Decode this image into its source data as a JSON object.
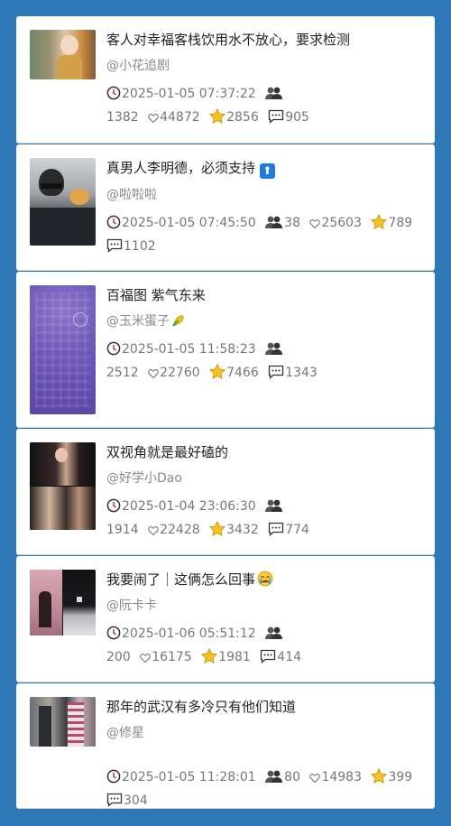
{
  "feed": [
    {
      "title": "客人对幸福客栈饮用水不放心，要求检测",
      "author": "@小花追剧",
      "time": "2025-01-05 07:37:22",
      "views": "1382",
      "likes": "44872",
      "stars": "2856",
      "comments": "905"
    },
    {
      "title": "真男人李明德，必须支持",
      "author": "@啦啦啦",
      "time": "2025-01-05 07:45:50",
      "views": "38",
      "likes": "25603",
      "stars": "789",
      "comments": "1102"
    },
    {
      "title": "百福图 紫气东来",
      "author": "@玉米蛋子",
      "time": "2025-01-05 11:58:23",
      "views": "2512",
      "likes": "22760",
      "stars": "7466",
      "comments": "1343"
    },
    {
      "title": "双视角就是最好磕的",
      "author": "@好学小Dao",
      "time": "2025-01-04 23:06:30",
      "views": "1914",
      "likes": "22428",
      "stars": "3432",
      "comments": "774"
    },
    {
      "title": "我要闹了｜这俩怎么回事",
      "author": "@阮卡卡",
      "time": "2025-01-06 05:51:12",
      "views": "200",
      "likes": "16175",
      "stars": "1981",
      "comments": "414"
    },
    {
      "title": "那年的武汉有多冷只有他们知道",
      "author": "@修星",
      "time": "2025-01-05 11:28:01",
      "views": "80",
      "likes": "14983",
      "stars": "399",
      "comments": "304"
    }
  ],
  "icons": [
    "clock-icon",
    "viewers-icon",
    "heart-icon",
    "star-icon",
    "comment-icon",
    "up-arrow-emoji",
    "corn-emoji",
    "crying-emoji"
  ]
}
